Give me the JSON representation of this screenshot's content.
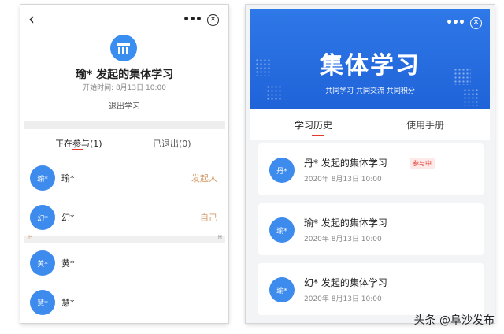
{
  "left": {
    "capsule": {
      "more": "•••",
      "close": "✕"
    },
    "title": "瑜* 发起的集体学习",
    "start_time": "开始时间: 8月13日 10:00",
    "exit_label": "退出学习",
    "tabs": [
      {
        "label": "正在参与(1)"
      },
      {
        "label": "已退出(0)"
      }
    ],
    "members": [
      {
        "avatar": "瑜*",
        "name": "瑜*",
        "role": "发起人"
      },
      {
        "avatar": "幻*",
        "name": "幻*",
        "role": "自己"
      },
      {
        "avatar": "黄*",
        "name": "黄*",
        "role": ""
      },
      {
        "avatar": "慧*",
        "name": "慧*",
        "role": ""
      }
    ],
    "separator": {
      "left": "H",
      "right": "H"
    }
  },
  "right": {
    "capsule": {
      "more": "•••",
      "close": "✕"
    },
    "banner": {
      "title": "集体学习",
      "subtitle": "共同学习  共同交流  共同积分"
    },
    "tabs": [
      {
        "label": "学习历史"
      },
      {
        "label": "使用手册"
      }
    ],
    "history": [
      {
        "avatar": "丹*",
        "title": "丹*  发起的集体学习",
        "date": "2020年 8月13日 10:00",
        "badge": "参与中"
      },
      {
        "avatar": "瑜*",
        "title": "瑜*  发起的集体学习",
        "date": "2020年 8月13日 10:00",
        "badge": ""
      },
      {
        "avatar": "瑜*",
        "title": "幻*  发起的集体学习",
        "date": "2020年 8月13日 10:00",
        "badge": ""
      }
    ]
  },
  "watermark": "头条 @阜沙发布",
  "colors": {
    "accent_blue": "#3d8bec",
    "accent_red": "#e23a2e",
    "role_orange": "#d49a6a",
    "banner_blue": "#2f78e8"
  }
}
